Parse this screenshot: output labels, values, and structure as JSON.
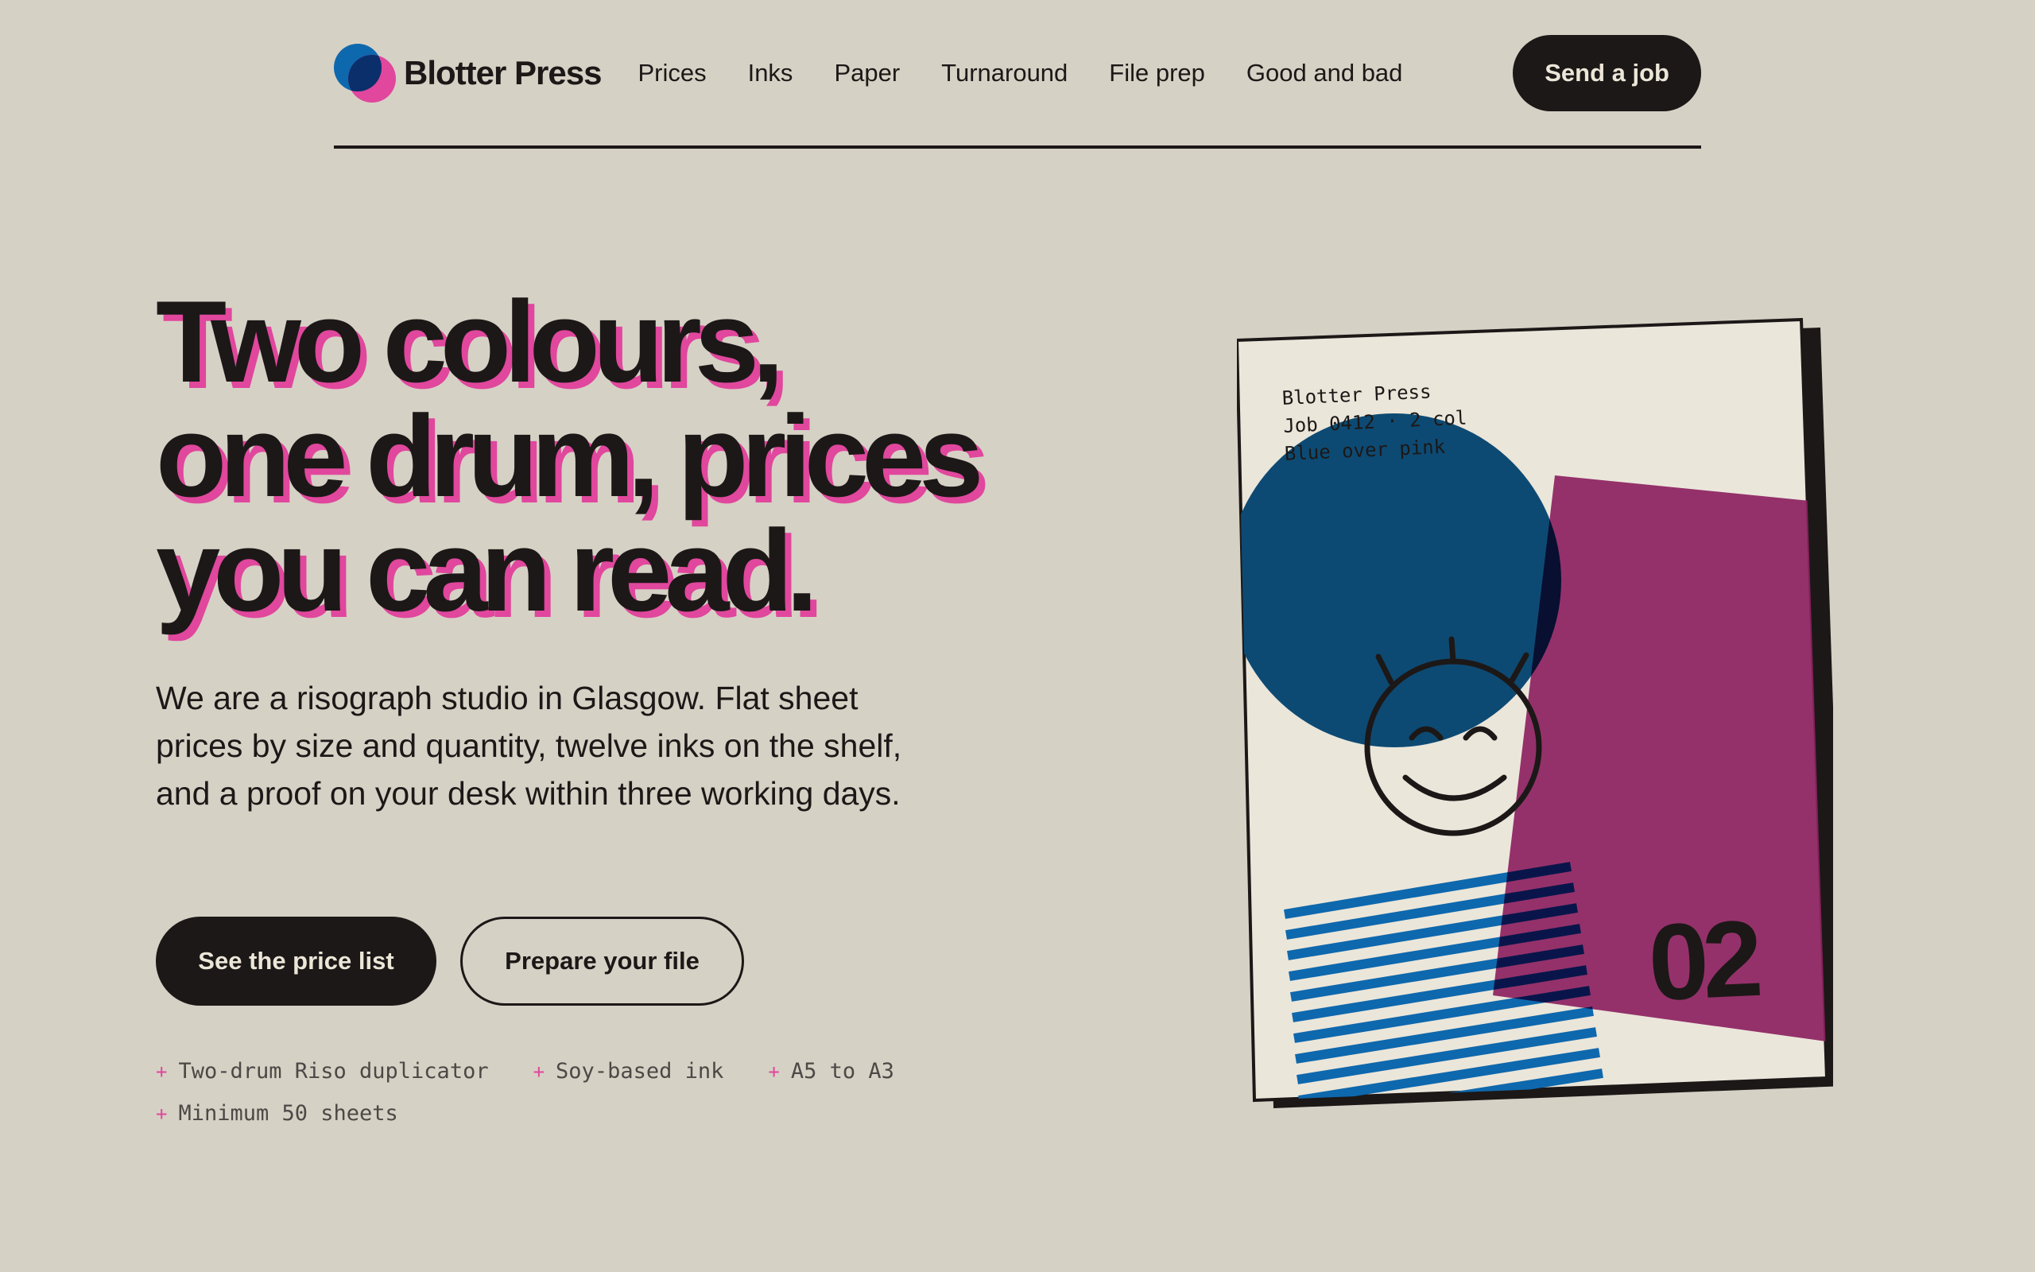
{
  "brand": {
    "name": "Blotter Press",
    "logo_colors": [
      "#0e68ad",
      "#e0479d"
    ]
  },
  "nav": {
    "links": [
      {
        "label": "Prices"
      },
      {
        "label": "Inks"
      },
      {
        "label": "Paper"
      },
      {
        "label": "Turnaround"
      },
      {
        "label": "File prep"
      },
      {
        "label": "Good and bad"
      }
    ],
    "cta_label": "Send a job"
  },
  "hero": {
    "title_lines": [
      "Two colours,",
      "one drum, prices",
      "you can read."
    ],
    "intro": "We are a risograph studio in Glasgow. Flat sheet prices by size and quantity, twelve inks on the shelf, and a proof on your desk within three working days.",
    "primary_button": "See the price list",
    "secondary_button": "Prepare your file",
    "features": [
      "Two-drum Riso duplicator",
      "Soy-based ink",
      "A5 to A3",
      "Minimum 50 sheets"
    ],
    "feature_bullet": "+"
  },
  "poster": {
    "meta_lines": [
      "Blotter Press",
      "Job 0412 · 2 col",
      "Blue over pink"
    ],
    "number": "02",
    "illustration_icon": "smiley-face-icon"
  },
  "colors": {
    "background": "#d6d1c5",
    "ink": "#1c1817",
    "riso_pink": "#e0479d",
    "riso_blue": "#0e68ad",
    "poster_magenta": "#8c2160",
    "poster_navy": "#0d4a73"
  }
}
